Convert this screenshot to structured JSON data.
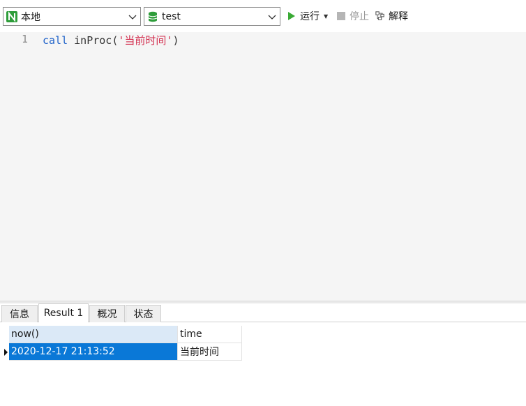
{
  "toolbar": {
    "connection": "本地",
    "database": "test",
    "run_label": "运行",
    "stop_label": "停止",
    "explain_label": "解释",
    "icons": {
      "connection": "navicat-connection-icon",
      "database": "database-icon",
      "run": "play-icon",
      "stop": "stop-icon",
      "explain": "explain-icon"
    },
    "colors": {
      "run_icon": "#3aaa35",
      "database_icon": "#2e9d3a",
      "connection_icon": "#2e9d3a"
    }
  },
  "editor": {
    "line_number": "1",
    "code": {
      "keyword": "call",
      "rest": " inProc(",
      "string": "'当前时间'",
      "end": ")"
    }
  },
  "tabs": [
    {
      "label": "信息"
    },
    {
      "label": "Result 1"
    },
    {
      "label": "概况"
    },
    {
      "label": "状态"
    }
  ],
  "active_tab": "Result 1",
  "result": {
    "columns": [
      "now()",
      "time"
    ],
    "rows": [
      [
        "2020-12-17 21:13:52",
        "当前时间"
      ]
    ],
    "selection_color": "#0a78d7"
  }
}
